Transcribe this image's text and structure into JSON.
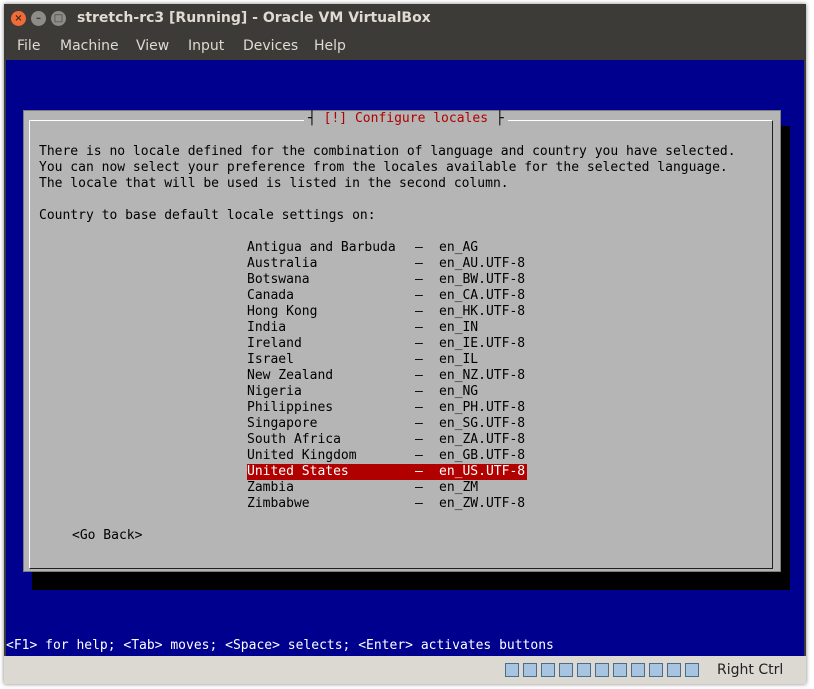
{
  "window": {
    "title": "stretch-rc3 [Running] - Oracle VM VirtualBox",
    "controls": {
      "close": "×",
      "minimize": "–",
      "maximize": "□"
    }
  },
  "menu": [
    "File",
    "Machine",
    "View",
    "Input",
    "Devices",
    "Help"
  ],
  "dialog": {
    "title": "[!] Configure locales",
    "text_lines": [
      "There is no locale defined for the combination of language and country you have selected.",
      "You can now select your preference from the locales available for the selected language.",
      "The locale that will be used is listed in the second column."
    ],
    "prompt": "Country to base default locale settings on:",
    "separator": "–",
    "locales": [
      {
        "country": "Antigua and Barbuda",
        "locale": "en_AG"
      },
      {
        "country": "Australia",
        "locale": "en_AU.UTF-8"
      },
      {
        "country": "Botswana",
        "locale": "en_BW.UTF-8"
      },
      {
        "country": "Canada",
        "locale": "en_CA.UTF-8"
      },
      {
        "country": "Hong Kong",
        "locale": "en_HK.UTF-8"
      },
      {
        "country": "India",
        "locale": "en_IN"
      },
      {
        "country": "Ireland",
        "locale": "en_IE.UTF-8"
      },
      {
        "country": "Israel",
        "locale": "en_IL"
      },
      {
        "country": "New Zealand",
        "locale": "en_NZ.UTF-8"
      },
      {
        "country": "Nigeria",
        "locale": "en_NG"
      },
      {
        "country": "Philippines",
        "locale": "en_PH.UTF-8"
      },
      {
        "country": "Singapore",
        "locale": "en_SG.UTF-8"
      },
      {
        "country": "South Africa",
        "locale": "en_ZA.UTF-8"
      },
      {
        "country": "United Kingdom",
        "locale": "en_GB.UTF-8"
      },
      {
        "country": "United States",
        "locale": "en_US.UTF-8"
      },
      {
        "country": "Zambia",
        "locale": "en_ZM"
      },
      {
        "country": "Zimbabwe",
        "locale": "en_ZW.UTF-8"
      }
    ],
    "selected_index": 14,
    "go_back": "<Go Back>"
  },
  "hint": "<F1> for help; <Tab> moves; <Space> selects; <Enter> activates buttons",
  "statusbar": {
    "icons": [
      "hard-disk-icon",
      "optical-drive-icon",
      "audio-icon",
      "network-icon",
      "usb-icon",
      "shared-folder-icon",
      "display-icon",
      "video-capture-icon",
      "cpu-icon",
      "mouse-integration-icon",
      "keyboard-icon"
    ],
    "host_key": "Right Ctrl"
  },
  "colors": {
    "vm_background": "#00008f",
    "dialog_background": "#b5b5b5",
    "selection": "#b00000",
    "titlebar": "#3c3b37"
  }
}
